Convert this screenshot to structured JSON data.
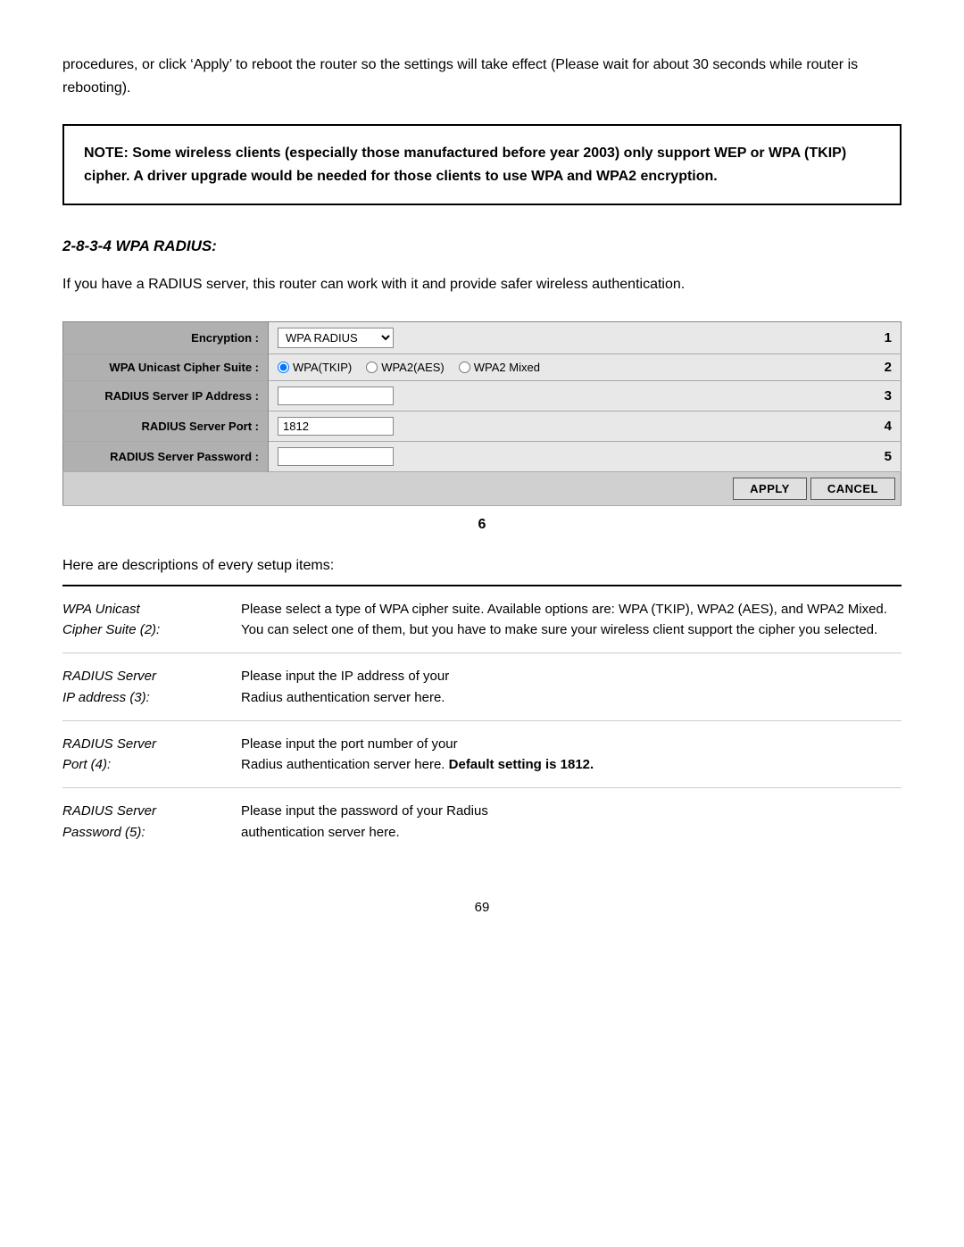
{
  "intro": {
    "text": "procedures, or click ‘Apply’ to reboot the router so the settings will take effect (Please wait for about 30 seconds while router is rebooting)."
  },
  "note": {
    "text": "NOTE: Some wireless clients (especially those manufactured before year 2003) only support WEP or WPA (TKIP) cipher. A driver upgrade would be needed for those clients to use WPA and WPA2 encryption."
  },
  "section": {
    "heading": "2-8-3-4 WPA RADIUS:",
    "desc": "If you have a RADIUS server, this router can work with it and provide safer wireless authentication."
  },
  "form": {
    "encryption_label": "Encryption :",
    "encryption_value": "WPA RADIUS",
    "encryption_num": "1",
    "cipher_label": "WPA Unicast Cipher Suite :",
    "cipher_options": [
      "WPA(TKIP)",
      "WPA2(AES)",
      "WPA2 Mixed"
    ],
    "cipher_selected": "WPA(TKIP)",
    "cipher_num": "2",
    "radius_ip_label": "RADIUS Server IP Address :",
    "radius_ip_num": "3",
    "radius_port_label": "RADIUS Server Port :",
    "radius_port_value": "1812",
    "radius_port_num": "4",
    "radius_pw_label": "RADIUS Server Password :",
    "radius_pw_num": "5",
    "apply_label": "APPLY",
    "cancel_label": "CANCEL",
    "num6": "6"
  },
  "desc": {
    "intro": "Here are descriptions of every setup items:",
    "items": [
      {
        "term1": "WPA Unicast",
        "term2": "Cipher Suite (2):",
        "def": "Please select a type of WPA cipher suite. Available options are: WPA (TKIP), WPA2 (AES), and WPA2 Mixed. You can select one of them, but you have to make sure your wireless client support the cipher you selected."
      },
      {
        "term1": "RADIUS Server",
        "term2": "IP address (3):",
        "def": "Please input the IP address of your Radius authentication server here."
      },
      {
        "term1": "RADIUS Server",
        "term2": "Port (4):",
        "def_plain": "Please input the port number of your Radius authentication server here. ",
        "def_bold": "Default setting is 1812."
      },
      {
        "term1": "RADIUS Server",
        "term2": "Password (5):",
        "def": "Please input the password of your Radius authentication server here."
      }
    ]
  },
  "page_number": "69"
}
